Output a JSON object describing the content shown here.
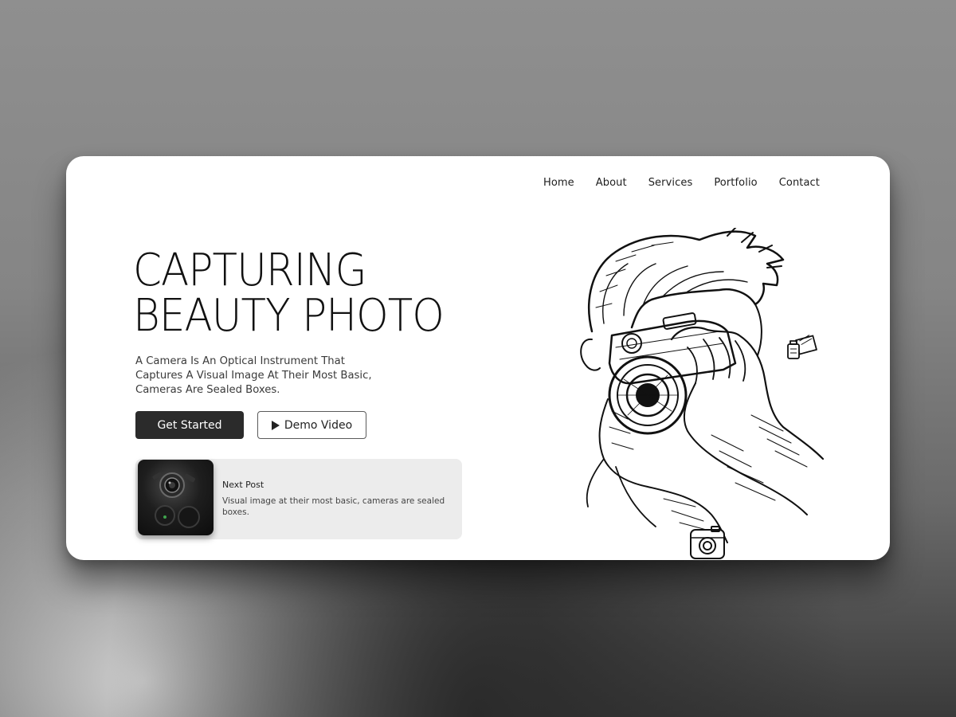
{
  "nav": {
    "items": [
      {
        "label": "Home"
      },
      {
        "label": "About"
      },
      {
        "label": "Services"
      },
      {
        "label": "Portfolio"
      },
      {
        "label": "Contact"
      }
    ]
  },
  "hero": {
    "title_line1": "CAPTURING",
    "title_line2": "BEAUTY PHOTO",
    "description": "A Camera Is An Optical Instrument That Captures A Visual Image At Their Most Basic, Cameras Are Sealed Boxes.",
    "primary_button": "Get Started",
    "secondary_button": "Demo Video"
  },
  "next_post": {
    "label": "Next Post",
    "text": "Visual image at their most basic, cameras are sealed boxes."
  },
  "icons": {
    "play": "play-icon",
    "film": "film-icon",
    "camera": "instant-camera-icon"
  },
  "colors": {
    "primary_button": "#2b2b2b",
    "card_background": "#ffffff",
    "post_background": "#ececec"
  }
}
